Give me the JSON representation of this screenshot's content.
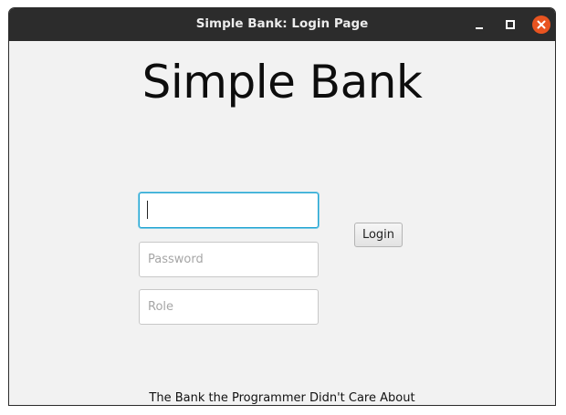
{
  "window": {
    "title": "Simple Bank: Login Page",
    "controls": [
      "minimize-icon",
      "maximize-icon",
      "close-icon"
    ],
    "close_color": "#e95420"
  },
  "main": {
    "heading": "Simple Bank",
    "username": {
      "value": "",
      "placeholder": ""
    },
    "password": {
      "value": "",
      "placeholder": "Password"
    },
    "role": {
      "value": "",
      "placeholder": "Role"
    },
    "login_label": "Login",
    "footer": "The Bank the Programmer Didn't Care About"
  }
}
